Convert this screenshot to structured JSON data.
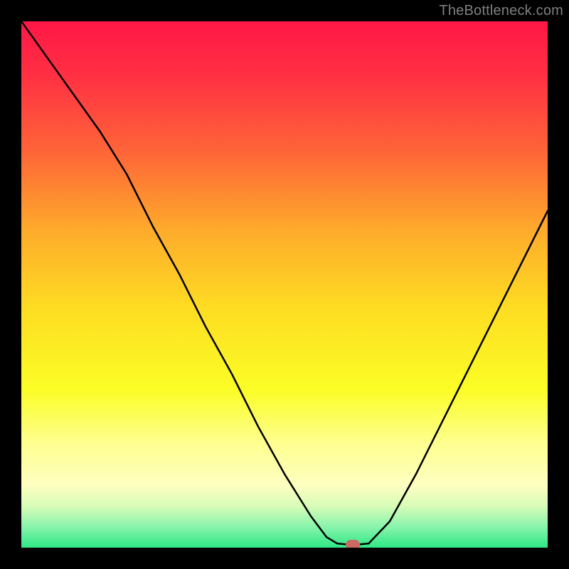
{
  "watermark": "TheBottleneck.com",
  "chart_data": {
    "type": "line",
    "title": "",
    "xlabel": "",
    "ylabel": "",
    "xlim": [
      0,
      100
    ],
    "ylim": [
      0,
      100
    ],
    "series": [
      {
        "name": "curve",
        "x": [
          0,
          5,
          10,
          15,
          20,
          25,
          30,
          35,
          40,
          45,
          50,
          55,
          58,
          60,
          62,
          64,
          66,
          70,
          75,
          80,
          85,
          90,
          95,
          100
        ],
        "y": [
          100,
          93,
          86,
          79,
          71,
          61,
          52,
          42,
          33,
          23,
          14,
          6,
          2,
          0.8,
          0.6,
          0.6,
          0.8,
          5,
          14,
          24,
          34,
          44,
          54,
          64
        ]
      }
    ],
    "marker": {
      "x": 63,
      "y": 0.6
    },
    "gradient_stops": [
      {
        "offset": 0.0,
        "color": "#ff1747"
      },
      {
        "offset": 0.1,
        "color": "#ff2f43"
      },
      {
        "offset": 0.25,
        "color": "#fe6638"
      },
      {
        "offset": 0.4,
        "color": "#feac2b"
      },
      {
        "offset": 0.55,
        "color": "#fede22"
      },
      {
        "offset": 0.7,
        "color": "#fbfd26"
      },
      {
        "offset": 0.8,
        "color": "#feff8e"
      },
      {
        "offset": 0.88,
        "color": "#feffc0"
      },
      {
        "offset": 0.92,
        "color": "#d9fcb8"
      },
      {
        "offset": 0.96,
        "color": "#89f4ac"
      },
      {
        "offset": 1.0,
        "color": "#2fe786"
      }
    ],
    "line_color": "#000000",
    "line_width": 2.5
  }
}
